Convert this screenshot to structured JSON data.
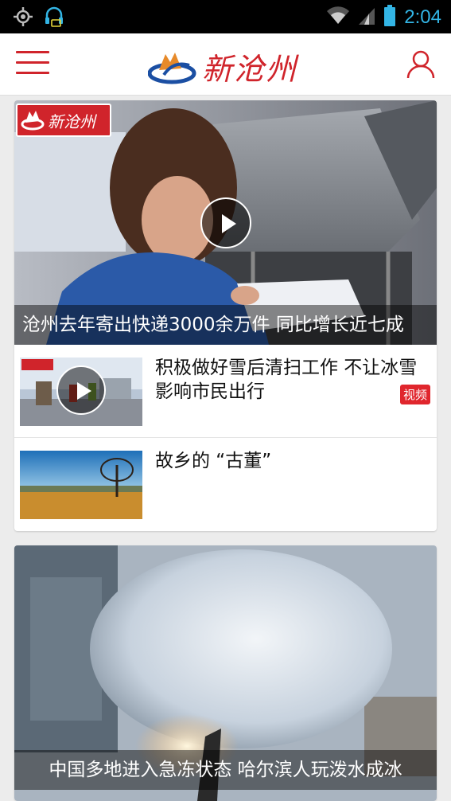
{
  "status_bar": {
    "time": "2:04",
    "icons": [
      "gps-icon",
      "headset-notification-icon",
      "wifi-icon",
      "cell-signal-icon",
      "battery-icon"
    ]
  },
  "header": {
    "logo_text": "新沧州",
    "menu_icon": "hamburger-menu-icon",
    "user_icon": "user-profile-icon",
    "accent_color": "#d0242b"
  },
  "feed": {
    "card1": {
      "hero": {
        "caption": "沧州去年寄出快递3000余万件 同比增长近七成",
        "watermark": "新沧州",
        "has_video": true
      },
      "items": [
        {
          "title": "积极做好雪后清扫工作 不让冰雪影响市民出行",
          "tag": "视频",
          "has_video": true
        },
        {
          "title": "故乡的 “古董”",
          "tag": "",
          "has_video": false
        }
      ]
    },
    "card2": {
      "hero": {
        "caption": "中国多地进入急冻状态 哈尔滨人玩泼水成冰"
      }
    }
  }
}
